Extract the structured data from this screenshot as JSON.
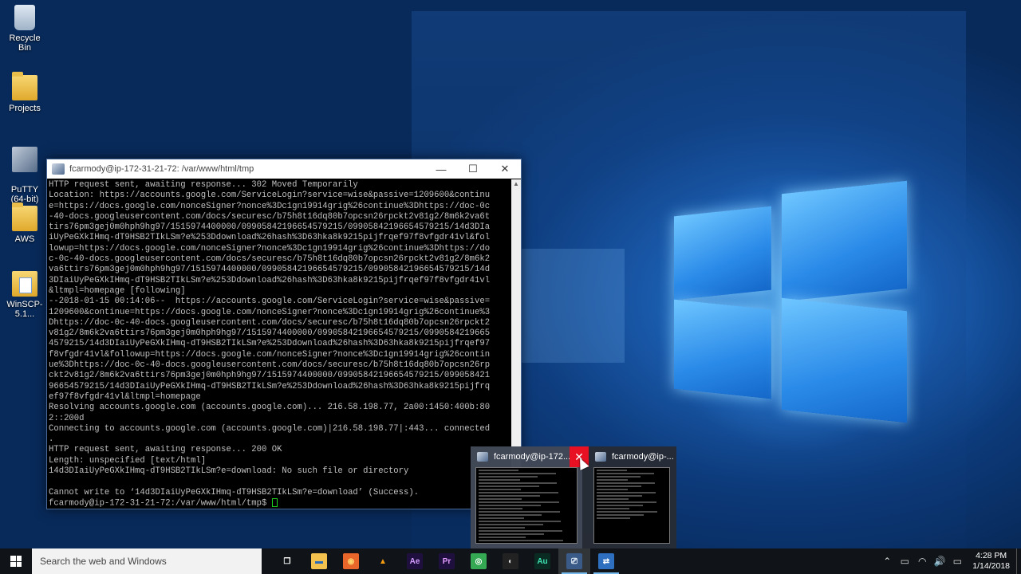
{
  "desktop": {
    "icons": [
      {
        "label": "Recycle Bin",
        "icon": "recycle-bin-icon"
      },
      {
        "label": "Projects",
        "icon": "folder-icon"
      },
      {
        "label": "PuTTY\n(64-bit)",
        "icon": "putty-icon"
      },
      {
        "label": "AWS",
        "icon": "folder-icon"
      },
      {
        "label": "WinSCP-5.1...",
        "icon": "winscp-icon"
      }
    ]
  },
  "terminal": {
    "title": "fcarmody@ip-172-31-21-72: /var/www/html/tmp",
    "controls": {
      "minimize": "—",
      "maximize": "☐",
      "close": "✕"
    },
    "lines": [
      "HTTP request sent, awaiting response... 302 Moved Temporarily",
      "Location: https://accounts.google.com/ServiceLogin?service=wise&passive=1209600&continu",
      "e=https://docs.google.com/nonceSigner?nonce%3Dc1gn19914grig%26continue%3Dhttps://doc-0c",
      "-40-docs.googleusercontent.com/docs/securesc/b75h8t16dq80b7opcsn26rpckt2v81g2/8m6k2va6t",
      "tirs76pm3gej0m0hph9hg97/1515974400000/09905842196654579215/09905842196654579215/14d3DIa",
      "iUyPeGXkIHmq-dT9HSB2TIkLSm?e%253Ddownload%26hash%3D63hka8k9215pijfrqef97f8vfgdr41vl&fol",
      "lowup=https://docs.google.com/nonceSigner?nonce%3Dc1gn19914grig%26continue%3Dhttps://do",
      "c-0c-40-docs.googleusercontent.com/docs/securesc/b75h8t16dq80b7opcsn26rpckt2v81g2/8m6k2",
      "va6ttirs76pm3gej0m0hph9hg97/1515974400000/09905842196654579215/09905842196654579215/14d",
      "3DIaiUyPeGXkIHmq-dT9HSB2TIkLSm?e%253Ddownload%26hash%3D63hka8k9215pijfrqef97f8vfgdr41vl",
      "&ltmpl=homepage [following]",
      "--2018-01-15 00:14:06--  https://accounts.google.com/ServiceLogin?service=wise&passive=",
      "1209600&continue=https://docs.google.com/nonceSigner?nonce%3Dc1gn19914grig%26continue%3",
      "Dhttps://doc-0c-40-docs.googleusercontent.com/docs/securesc/b75h8t16dq80b7opcsn26rpckt2",
      "v81g2/8m6k2va6ttirs76pm3gej0m0hph9hg97/1515974400000/09905842196654579215/0990584219665",
      "4579215/14d3DIaiUyPeGXkIHmq-dT9HSB2TIkLSm?e%253Ddownload%26hash%3D63hka8k9215pijfrqef97",
      "f8vfgdr41vl&followup=https://docs.google.com/nonceSigner?nonce%3Dc1gn19914grig%26contin",
      "ue%3Dhttps://doc-0c-40-docs.googleusercontent.com/docs/securesc/b75h8t16dq80b7opcsn26rp",
      "ckt2v81g2/8m6k2va6ttirs76pm3gej0m0hph9hg97/1515974400000/09905842196654579215/099058421",
      "96654579215/14d3DIaiUyPeGXkIHmq-dT9HSB2TIkLSm?e%253Ddownload%26hash%3D63hka8k9215pijfrq",
      "ef97f8vfgdr41vl&ltmpl=homepage",
      "Resolving accounts.google.com (accounts.google.com)... 216.58.198.77, 2a00:1450:400b:80",
      "2::200d",
      "Connecting to accounts.google.com (accounts.google.com)|216.58.198.77|:443... connected",
      ".",
      "HTTP request sent, awaiting response... 200 OK",
      "Length: unspecified [text/html]",
      "14d3DIaiUyPeGXkIHmq-dT9HSB2TIkLSm?e=download: No such file or directory",
      "",
      "Cannot write to ‘14d3DIaiUyPeGXkIHmq-dT9HSB2TIkLSm?e=download’ (Success).",
      "fcarmody@ip-172-31-21-72:/var/www/html/tmp$ "
    ]
  },
  "preview": {
    "thumb1_title": "fcarmody@ip-172...",
    "thumb2_title": "fcarmody@ip-...",
    "close_label": "✕"
  },
  "taskbar": {
    "search_placeholder": "Search the web and Windows",
    "apps": [
      {
        "name": "task-view",
        "glyph": "❐",
        "bg": "transparent",
        "fg": "#ffffff"
      },
      {
        "name": "file-explorer",
        "glyph": "▬",
        "bg": "#f2c14e",
        "fg": "#2a6ab8"
      },
      {
        "name": "firefox",
        "glyph": "◉",
        "bg": "#e8662a",
        "fg": "#ffd36b"
      },
      {
        "name": "vlc",
        "glyph": "▲",
        "bg": "transparent",
        "fg": "#f39c12"
      },
      {
        "name": "after-effects",
        "glyph": "Ae",
        "bg": "#1f0f3f",
        "fg": "#d49dff"
      },
      {
        "name": "premiere",
        "glyph": "Pr",
        "bg": "#1f0f3f",
        "fg": "#e39dff"
      },
      {
        "name": "chrome",
        "glyph": "◎",
        "bg": "#34a853",
        "fg": "#ffffff"
      },
      {
        "name": "obs",
        "glyph": "◐",
        "bg": "#222222",
        "fg": "#dddddd"
      },
      {
        "name": "audition",
        "glyph": "Au",
        "bg": "#0a2b22",
        "fg": "#3fe3b3"
      },
      {
        "name": "putty",
        "glyph": "⎚",
        "bg": "#3a5a88",
        "fg": "#dfe8f2"
      },
      {
        "name": "winscp",
        "glyph": "⇄",
        "bg": "#2e6fbf",
        "fg": "#ffffff"
      }
    ],
    "tray": {
      "chevron": "⌃",
      "battery": "▭",
      "network": "◠",
      "volume": "🔊",
      "notifications": "▭"
    },
    "time": "4:28 PM",
    "date": "1/14/2018",
    "accent": "#76b9ed"
  }
}
